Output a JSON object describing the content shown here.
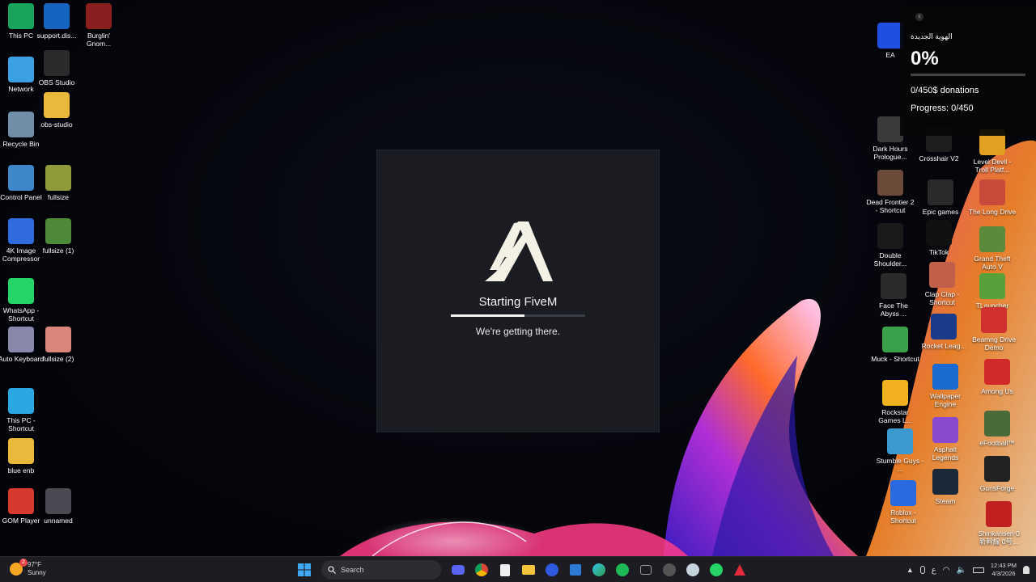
{
  "desktop_icons_left": [
    {
      "label": "This PC",
      "icon": "this-pc-icon",
      "color": "#1aa35b"
    },
    {
      "label": "support.dis...",
      "icon": "edge-icon",
      "color": "#1565c0"
    },
    {
      "label": "Burglin' Gnom...",
      "icon": "game-icon",
      "color": "#8b1e1e"
    },
    {
      "label": "Network",
      "icon": "network-icon",
      "color": "#3aa0e0"
    },
    {
      "label": "OBS Studio",
      "icon": "obs-icon",
      "color": "#2b2b2b"
    },
    {
      "label": "obs-studio",
      "icon": "folder-icon",
      "color": "#e8b93a"
    },
    {
      "label": "Recycle Bin",
      "icon": "recycle-bin-icon",
      "color": "#6f8fa8"
    },
    {
      "label": "Control Panel",
      "icon": "control-panel-icon",
      "color": "#3d87c9"
    },
    {
      "label": "fullsize",
      "icon": "image-icon",
      "color": "#8e9a3a"
    },
    {
      "label": "4K Image Compressor",
      "icon": "compressor-icon",
      "color": "#2f6bdc"
    },
    {
      "label": "fullsize (1)",
      "icon": "image-icon",
      "color": "#4c8a3a"
    },
    {
      "label": "WhatsApp - Shortcut",
      "icon": "whatsapp-icon",
      "color": "#25d366"
    },
    {
      "label": "Auto Keyboard",
      "icon": "keyboard-icon",
      "color": "#8888aa"
    },
    {
      "label": "fullsize (2)",
      "icon": "image-icon",
      "color": "#d9867a"
    },
    {
      "label": "This PC - Shortcut",
      "icon": "monitor-icon",
      "color": "#2aa6e0"
    },
    {
      "label": "blue enb",
      "icon": "folder-icon",
      "color": "#e8b93a"
    },
    {
      "label": "GOM Player",
      "icon": "gom-player-icon",
      "color": "#d63a2f"
    },
    {
      "label": "unnamed",
      "icon": "image-icon",
      "color": "#4a4a52"
    }
  ],
  "desktop_icons_right": [
    {
      "label": "EA",
      "icon": "ea-icon",
      "color": "#1f4fe0"
    },
    {
      "label": "Dark Hours Prologue...",
      "icon": "game-icon",
      "color": "#3b3b3b"
    },
    {
      "label": "Crosshair V2",
      "icon": "crosshair-icon",
      "color": "#1e1e1e"
    },
    {
      "label": "Level Devil - Troll Platf...",
      "icon": "game-icon",
      "color": "#e0a020"
    },
    {
      "label": "Dead Frontier 2 - Shortcut",
      "icon": "game-icon",
      "color": "#6b4a3a"
    },
    {
      "label": "Epic games",
      "icon": "epic-games-icon",
      "color": "#2a2a2a"
    },
    {
      "label": "The Long Drive",
      "icon": "game-icon",
      "color": "#c84a3a"
    },
    {
      "label": "Double Shoulder...",
      "icon": "game-icon",
      "color": "#1a1a1a"
    },
    {
      "label": "TikTok",
      "icon": "tiktok-icon",
      "color": "#111111"
    },
    {
      "label": "Grand Theft Auto V",
      "icon": "gta-icon",
      "color": "#5a8a3a"
    },
    {
      "label": "Face The Abyss ...",
      "icon": "game-icon",
      "color": "#2a2a2a"
    },
    {
      "label": "Clap Clap - Shortcut",
      "icon": "game-icon",
      "color": "#c0604a"
    },
    {
      "label": "TLauncher",
      "icon": "minecraft-icon",
      "color": "#5aa03a"
    },
    {
      "label": "Rocket Leag...",
      "icon": "rocket-league-icon",
      "color": "#1a3a8a"
    },
    {
      "label": "Beamng Drive Demo",
      "icon": "game-icon",
      "color": "#d03030"
    },
    {
      "label": "Muck - Shortcut",
      "icon": "game-icon",
      "color": "#3aa04a"
    },
    {
      "label": "Wallpaper Engine",
      "icon": "wallpaper-engine-icon",
      "color": "#1a6ad0"
    },
    {
      "label": "Among Us",
      "icon": "among-us-icon",
      "color": "#d02a2a"
    },
    {
      "label": "Rockstar Games L...",
      "icon": "rockstar-icon",
      "color": "#f0b020"
    },
    {
      "label": "Asphalt Legends",
      "icon": "game-icon",
      "color": "#8a4ad0"
    },
    {
      "label": "eFootball™",
      "icon": "game-icon",
      "color": "#4a6a3a"
    },
    {
      "label": "Stumble Guys - ...",
      "icon": "game-icon",
      "color": "#3a9ad0"
    },
    {
      "label": "Steam",
      "icon": "steam-icon",
      "color": "#1b2838"
    },
    {
      "label": "GunsForge",
      "icon": "game-icon",
      "color": "#222222"
    },
    {
      "label": "Roblox - Shortcut",
      "icon": "roblox-icon",
      "color": "#2a6ae0"
    },
    {
      "label": "Shinkansen 0 新幹線 0号...",
      "icon": "game-icon",
      "color": "#c02020"
    }
  ],
  "fivem": {
    "title": "Starting FiveM",
    "subtitle": "We're getting there.",
    "progress": 0.55
  },
  "donation": {
    "icon_text": "c",
    "name": "الهوية الجديدة",
    "percent": "0%",
    "donations": "0/450$ donations",
    "progress": "Progress: 0/450",
    "fill": 0
  },
  "taskbar": {
    "weather_temp": "97°F",
    "weather_desc": "Sunny",
    "weather_badge": "2",
    "search_placeholder": "Search",
    "time": "12:43 PM",
    "date": "4/3/2026",
    "lang": "ع"
  }
}
